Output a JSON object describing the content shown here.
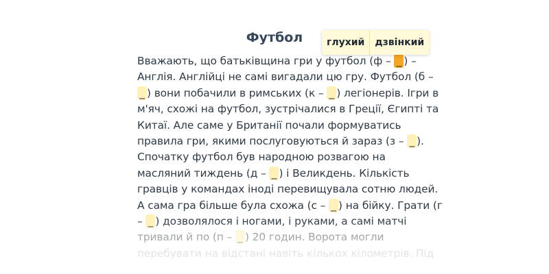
{
  "title": "Футбол",
  "popup": {
    "option_voiceless": "глухий",
    "option_voiced": "дзвінкий"
  },
  "text_lines": [
    [
      "Вважають, що батьківщина гри у футбол (ф – ",
      {
        "blank": "_",
        "active": true
      },
      ") –"
    ],
    [
      "Англія. Англійці не самі вигадали цю гру. Футбол (б –"
    ],
    [
      {
        "blank": "_"
      },
      ") вони побачили в римських (к – ",
      {
        "blank": "_"
      },
      ") легіонерів. Ігри в"
    ],
    [
      "м'яч, схожі на футбол, зустрічалися в Греції, Єгипті та"
    ],
    [
      "Китаї. Але саме у Британії почали формуватись"
    ],
    [
      "правила гри, якими послуговуються й зараз (з – ",
      {
        "blank": "_"
      },
      ")."
    ],
    [
      "Спочатку футбол був народною розвагою на"
    ],
    [
      "масляний тиждень (д – ",
      {
        "blank": "_"
      },
      ") і Великдень. Кількість"
    ],
    [
      "гравців у командах іноді перевищувала сотню людей."
    ],
    [
      "А сама гра більше була схожа (с – ",
      {
        "blank": "_"
      },
      ") на бійку. Грати (г"
    ],
    [
      "– ",
      {
        "blank": "_"
      },
      ") дозволялося і ногами, і руками, а самі матчі"
    ],
    [
      "тривали й по (п – ",
      {
        "blank": "_"
      },
      ") 20 годин. Ворота могли"
    ],
    [
      "перебувати на відстані навіть кількох кілометрів. Під"
    ]
  ]
}
